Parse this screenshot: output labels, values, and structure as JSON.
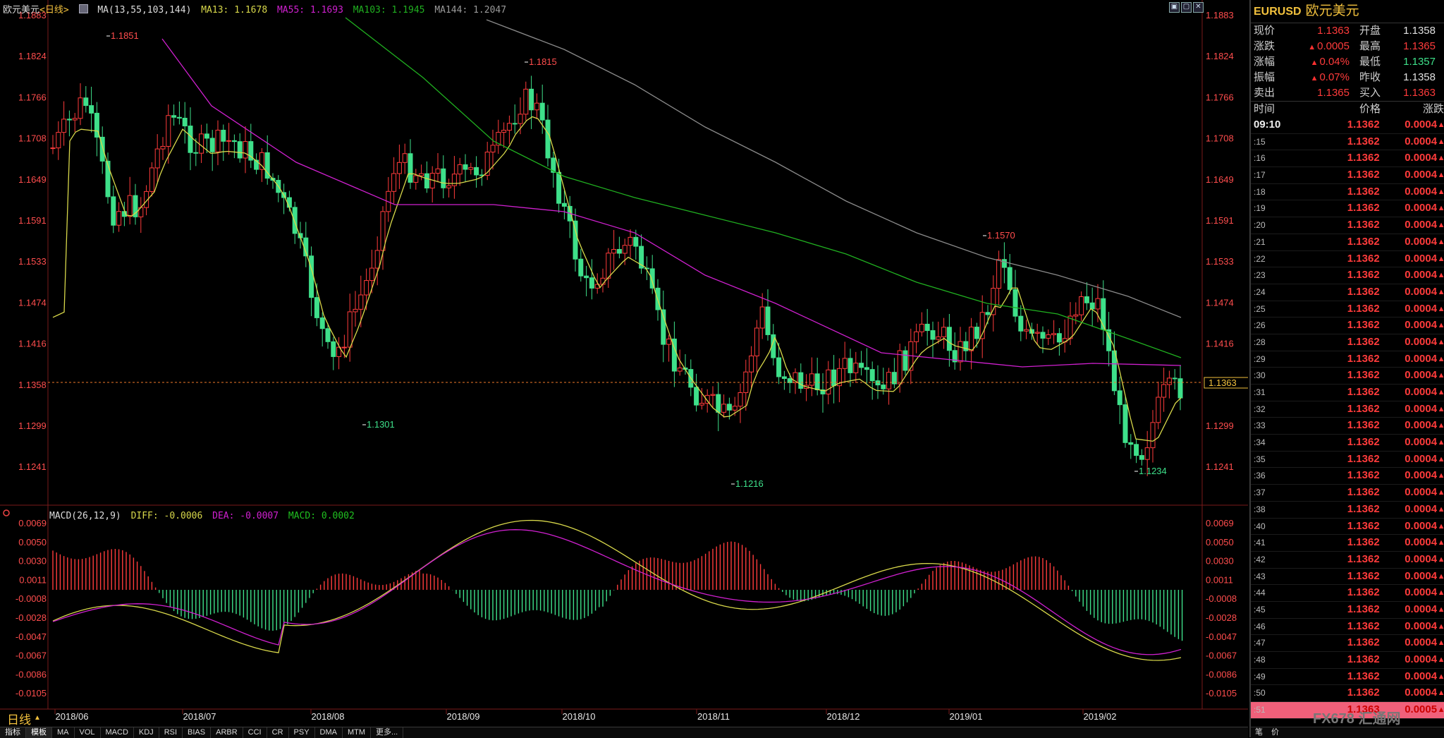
{
  "main_legend": {
    "symbol": "欧元美元",
    "period": "日线",
    "ma_label": "MA(13,55,103,144)",
    "ma13": "MA13: 1.1678",
    "ma55": "MA55: 1.1693",
    "ma103": "MA103: 1.1945",
    "ma144": "MA144: 1.2047"
  },
  "macd_legend": {
    "label": "MACD(26,12,9)",
    "diff": "DIFF: -0.0006",
    "dea": "DEA: -0.0007",
    "macd": "MACD: 0.0002"
  },
  "price_axis": [
    "1.1883",
    "1.1824",
    "1.1766",
    "1.1708",
    "1.1649",
    "1.1591",
    "1.1533",
    "1.1474",
    "1.1416",
    "1.1358",
    "1.1299",
    "1.1241"
  ],
  "macd_axis": [
    "0.0069",
    "0.0050",
    "0.0030",
    "0.0011",
    "-0.0008",
    "-0.0028",
    "-0.0047",
    "-0.0067",
    "-0.0086",
    "-0.0105"
  ],
  "time_axis": [
    "2018/06",
    "2018/07",
    "2018/08",
    "2018/09",
    "2018/10",
    "2018/11",
    "2018/12",
    "2019/01",
    "2019/02"
  ],
  "current_price_tag": "1.1363",
  "annotations": [
    {
      "text": "1.1851",
      "kind": "high"
    },
    {
      "text": "1.1815",
      "kind": "high"
    },
    {
      "text": "1.1570",
      "kind": "high"
    },
    {
      "text": "1.1301",
      "kind": "low"
    },
    {
      "text": "1.1216",
      "kind": "low"
    },
    {
      "text": "1.1234",
      "kind": "low"
    }
  ],
  "timeframe_label": "日线",
  "bottom_tabs": [
    "指标",
    "模板",
    "MA",
    "VOL",
    "MACD",
    "KDJ",
    "RSI",
    "BIAS",
    "ARBR",
    "CCI",
    "CR",
    "PSY",
    "DMA",
    "MTM",
    "更多..."
  ],
  "colors": {
    "up": "#ff3b3b",
    "down": "#3ee08a",
    "ma13": "#d8d84a",
    "ma55": "#d020d0",
    "ma103": "#20b020",
    "ma144": "#8a8a8a",
    "accent": "#f2c13d"
  },
  "panel": {
    "code": "EURUSD",
    "name": "欧元美元",
    "rows": [
      {
        "l1": "现价",
        "v1": "1.1363",
        "l2": "开盘",
        "v2": "1.1358",
        "c1": "#ff3b3b",
        "c2": "#e0e0e0",
        "arrow": false
      },
      {
        "l1": "涨跌",
        "v1": "0.0005",
        "l2": "最高",
        "v2": "1.1365",
        "c1": "#ff3b3b",
        "c2": "#ff3b3b",
        "arrow": true
      },
      {
        "l1": "涨幅",
        "v1": "0.04%",
        "l2": "最低",
        "v2": "1.1357",
        "c1": "#ff3b3b",
        "c2": "#3ee08a",
        "arrow": true
      },
      {
        "l1": "振幅",
        "v1": "0.07%",
        "l2": "昨收",
        "v2": "1.1358",
        "c1": "#ff3b3b",
        "c2": "#e0e0e0",
        "arrow": true
      },
      {
        "l1": "卖出",
        "v1": "1.1365",
        "l2": "买入",
        "v2": "1.1363",
        "c1": "#ff3b3b",
        "c2": "#ff3b3b",
        "arrow": false
      }
    ],
    "ticks_header": [
      "时间",
      "价格",
      "涨跌"
    ],
    "ticks": [
      {
        "t": "09:10",
        "p": "1.1362",
        "c": "0.0004"
      },
      {
        "t": ":15",
        "p": "1.1362",
        "c": "0.0004"
      },
      {
        "t": ":16",
        "p": "1.1362",
        "c": "0.0004"
      },
      {
        "t": ":17",
        "p": "1.1362",
        "c": "0.0004"
      },
      {
        "t": ":18",
        "p": "1.1362",
        "c": "0.0004"
      },
      {
        "t": ":19",
        "p": "1.1362",
        "c": "0.0004"
      },
      {
        "t": ":20",
        "p": "1.1362",
        "c": "0.0004"
      },
      {
        "t": ":21",
        "p": "1.1362",
        "c": "0.0004"
      },
      {
        "t": ":22",
        "p": "1.1362",
        "c": "0.0004"
      },
      {
        "t": ":23",
        "p": "1.1362",
        "c": "0.0004"
      },
      {
        "t": ":24",
        "p": "1.1362",
        "c": "0.0004"
      },
      {
        "t": ":25",
        "p": "1.1362",
        "c": "0.0004"
      },
      {
        "t": ":26",
        "p": "1.1362",
        "c": "0.0004"
      },
      {
        "t": ":28",
        "p": "1.1362",
        "c": "0.0004"
      },
      {
        "t": ":29",
        "p": "1.1362",
        "c": "0.0004"
      },
      {
        "t": ":30",
        "p": "1.1362",
        "c": "0.0004"
      },
      {
        "t": ":31",
        "p": "1.1362",
        "c": "0.0004"
      },
      {
        "t": ":32",
        "p": "1.1362",
        "c": "0.0004"
      },
      {
        "t": ":33",
        "p": "1.1362",
        "c": "0.0004"
      },
      {
        "t": ":34",
        "p": "1.1362",
        "c": "0.0004"
      },
      {
        "t": ":35",
        "p": "1.1362",
        "c": "0.0004"
      },
      {
        "t": ":36",
        "p": "1.1362",
        "c": "0.0004"
      },
      {
        "t": ":37",
        "p": "1.1362",
        "c": "0.0004"
      },
      {
        "t": ":38",
        "p": "1.1362",
        "c": "0.0004"
      },
      {
        "t": ":40",
        "p": "1.1362",
        "c": "0.0004"
      },
      {
        "t": ":41",
        "p": "1.1362",
        "c": "0.0004"
      },
      {
        "t": ":42",
        "p": "1.1362",
        "c": "0.0004"
      },
      {
        "t": ":43",
        "p": "1.1362",
        "c": "0.0004"
      },
      {
        "t": ":44",
        "p": "1.1362",
        "c": "0.0004"
      },
      {
        "t": ":45",
        "p": "1.1362",
        "c": "0.0004"
      },
      {
        "t": ":46",
        "p": "1.1362",
        "c": "0.0004"
      },
      {
        "t": ":47",
        "p": "1.1362",
        "c": "0.0004"
      },
      {
        "t": ":48",
        "p": "1.1362",
        "c": "0.0004"
      },
      {
        "t": ":49",
        "p": "1.1362",
        "c": "0.0004"
      },
      {
        "t": ":50",
        "p": "1.1362",
        "c": "0.0004"
      },
      {
        "t": ":51",
        "p": "1.1363",
        "c": "0.0005"
      }
    ],
    "footer": [
      "笔",
      "价"
    ],
    "watermark": "FX678 汇通网"
  }
}
